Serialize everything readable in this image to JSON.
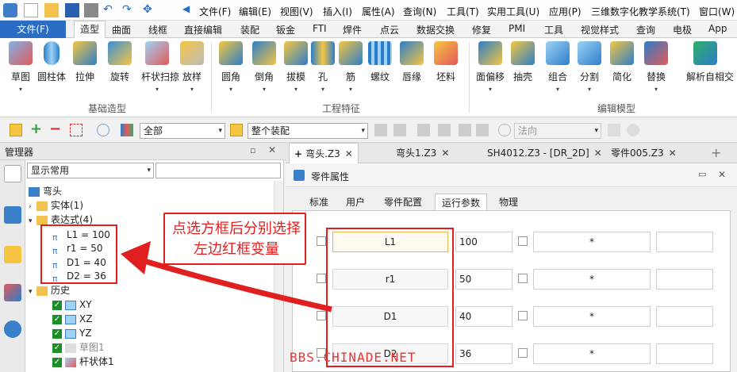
{
  "menu": {
    "items": [
      "文件(F)",
      "编辑(E)",
      "视图(V)",
      "插入(I)",
      "属性(A)",
      "查询(N)",
      "工具(T)",
      "实用工具(U)",
      "应用(P)",
      "三维数字化教学系统(T)",
      "窗口(W)"
    ]
  },
  "ribbon_tabs": {
    "file": "文件(F)",
    "items": [
      "造型",
      "曲面",
      "线框",
      "直接编辑",
      "装配",
      "钣金",
      "FTI",
      "焊件",
      "点云",
      "数据交换",
      "修复",
      "PMI",
      "工具",
      "视觉样式",
      "查询",
      "电极",
      "App"
    ],
    "active_index": 0
  },
  "ribbon": {
    "group1": {
      "label": "基础造型",
      "buttons": [
        "草图",
        "圆柱体",
        "拉伸",
        "旋转",
        "杆状扫掠",
        "放样"
      ]
    },
    "group2": {
      "label": "工程特征",
      "buttons": [
        "圆角",
        "倒角",
        "拔模",
        "孔",
        "筋",
        "螺纹",
        "唇缘",
        "坯料"
      ]
    },
    "group3": {
      "label": "编辑模型",
      "buttons": [
        "面偏移",
        "抽壳",
        "组合",
        "分割",
        "简化",
        "替换",
        "解析自相交"
      ]
    }
  },
  "toolbar": {
    "filter_combo": "全部",
    "scope_combo": "整个装配",
    "direction_combo": "法向"
  },
  "manager": {
    "title": "管理器",
    "display_combo": "显示常用",
    "tree": {
      "root": "弯头",
      "solid": "实体(1)",
      "expressions": "表达式(4)",
      "vars": [
        "L1 = 100",
        "r1 = 50",
        "D1 = 40",
        "D2 = 36"
      ],
      "history": "历史",
      "history_items": [
        "XY",
        "XZ",
        "YZ",
        "草图1",
        "杆状体1"
      ]
    }
  },
  "doc_tabs": [
    {
      "label": "弯头.Z3",
      "active": true
    },
    {
      "label": "弯头1.Z3",
      "active": false
    },
    {
      "label": "SH4012.Z3 - [DR_2D]",
      "active": false
    },
    {
      "label": "零件005.Z3",
      "active": false
    }
  ],
  "properties": {
    "title": "零件属性",
    "tabs": [
      "标准",
      "用户",
      "零件配置",
      "运行参数",
      "物理"
    ],
    "active_tab": 3,
    "rows": [
      {
        "name": "L1",
        "value": "100",
        "tol": "*"
      },
      {
        "name": "r1",
        "value": "50",
        "tol": "*"
      },
      {
        "name": "D1",
        "value": "40",
        "tol": "*"
      },
      {
        "name": "D2",
        "value": "36",
        "tol": "*"
      }
    ]
  },
  "annotation": {
    "callout": "点选方框后分别选择左边红框变量"
  },
  "watermark": "BBS.CHINADE.NET",
  "colors": {
    "accent": "#2b6cc4",
    "annotation_red": "#e02020"
  }
}
